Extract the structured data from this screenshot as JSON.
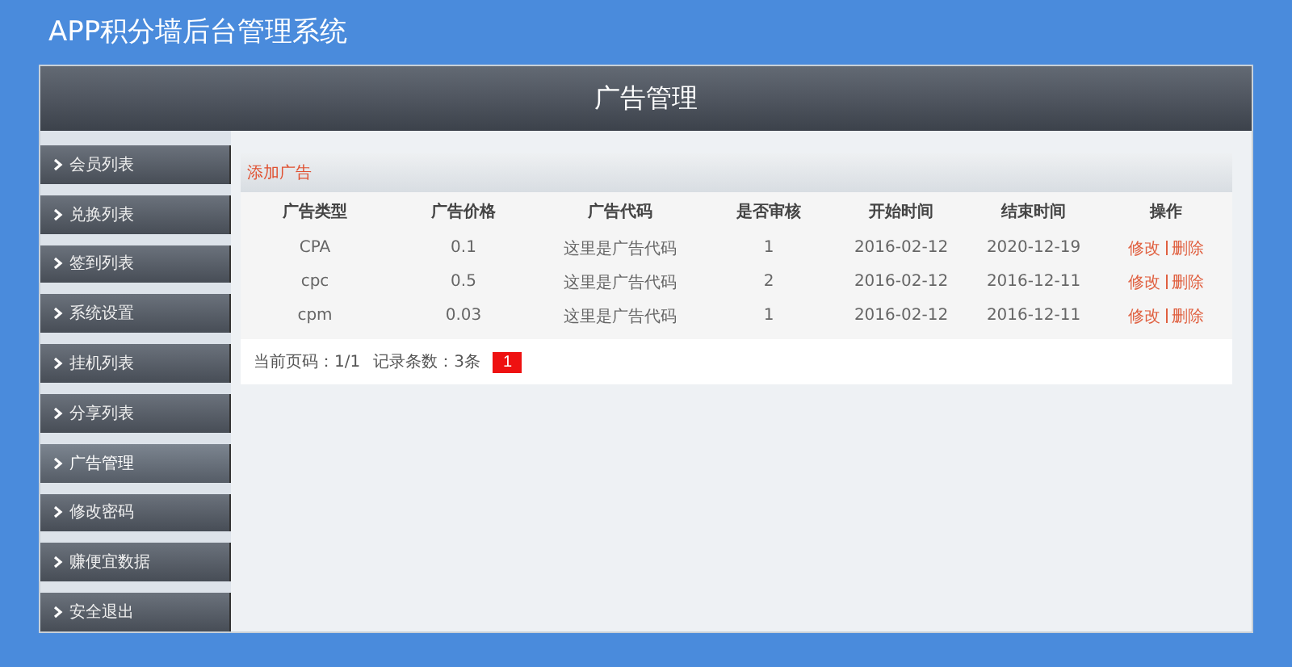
{
  "app_title": "APP积分墙后台管理系统",
  "header": {
    "title": "广告管理"
  },
  "sidebar": {
    "items": [
      {
        "label": "会员列表",
        "selected": false
      },
      {
        "label": "兑换列表",
        "selected": false
      },
      {
        "label": "签到列表",
        "selected": false
      },
      {
        "label": "系统设置",
        "selected": false
      },
      {
        "label": "挂机列表",
        "selected": false
      },
      {
        "label": "分享列表",
        "selected": false
      },
      {
        "label": "广告管理",
        "selected": true
      },
      {
        "label": "修改密码",
        "selected": false
      },
      {
        "label": "赚便宜数据",
        "selected": false
      },
      {
        "label": "安全退出",
        "selected": false
      }
    ]
  },
  "toolbar": {
    "add_link": "添加广告"
  },
  "table": {
    "columns": [
      "广告类型",
      "广告价格",
      "广告代码",
      "是否审核",
      "开始时间",
      "结束时间",
      "操作"
    ],
    "rows": [
      {
        "cells": [
          "CPA",
          "0.1",
          "这里是广告代码",
          "1",
          "2016-02-12",
          "2020-12-19"
        ],
        "actions": [
          "修改",
          "删除"
        ]
      },
      {
        "cells": [
          "cpc",
          "0.5",
          "这里是广告代码",
          "2",
          "2016-02-12",
          "2016-12-11"
        ],
        "actions": [
          "修改",
          "删除"
        ]
      },
      {
        "cells": [
          "cpm",
          "0.03",
          "这里是广告代码",
          "1",
          "2016-02-12",
          "2016-12-11"
        ],
        "actions": [
          "修改",
          "删除"
        ]
      }
    ]
  },
  "pagination": {
    "current_page": "当前页码：1/1",
    "record_count": "记录条数：3条",
    "pages": [
      {
        "label": "1",
        "selected": true
      }
    ]
  }
}
